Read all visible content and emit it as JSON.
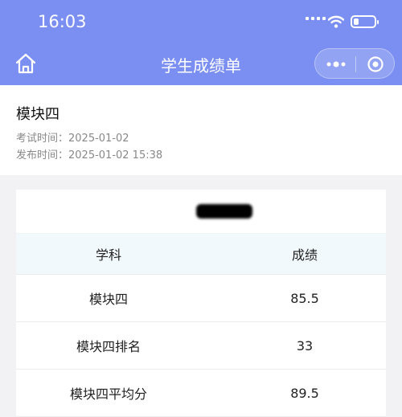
{
  "status_bar": {
    "time": "16:03"
  },
  "nav": {
    "title": "学生成绩单"
  },
  "info": {
    "module_name": "模块四",
    "exam_time": "考试时间：2025-01-02",
    "publish_time": "发布时间：2025-01-02 15:38"
  },
  "table": {
    "headers": [
      "学科",
      "成绩"
    ],
    "rows": [
      {
        "subject": "模块四",
        "score": "85.5"
      },
      {
        "subject": "模块四排名",
        "score": "33"
      },
      {
        "subject": "模块四平均分",
        "score": "89.5"
      }
    ]
  },
  "colors": {
    "primary": "#7b8ff2",
    "header_bg": "#f2f9fc"
  }
}
